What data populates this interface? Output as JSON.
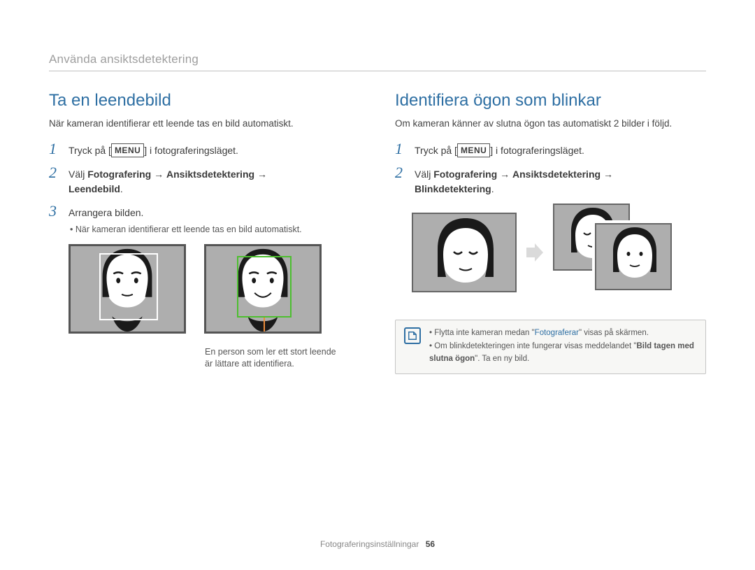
{
  "breadcrumb": "Använda ansiktsdetektering",
  "left": {
    "title": "Ta en leendebild",
    "intro": "När kameran identifierar ett leende tas en bild automatiskt.",
    "step1_pre": "Tryck på [",
    "menu_label": "MENU",
    "step1_post": "] i fotograferingsläget.",
    "step2_pre": "Välj ",
    "step2_b1": "Fotografering",
    "step2_arrow": " → ",
    "step2_b2": "Ansiktsdetektering",
    "step2_b3": "Leendebild",
    "step2_post": ".",
    "step3": "Arrangera bilden.",
    "sub_bullet": "När kameran identifierar ett leende tas en bild automatiskt.",
    "caption": "En person som ler ett stort leende är lättare att identifiera."
  },
  "right": {
    "title": "Identifiera ögon som blinkar",
    "intro": "Om kameran känner av slutna ögon tas automatiskt 2 bilder i följd.",
    "step1_pre": "Tryck på [",
    "menu_label": "MENU",
    "step1_post": "] i fotograferingsläget.",
    "step2_pre": "Välj ",
    "step2_b1": "Fotografering",
    "step2_arrow": " → ",
    "step2_b2": "Ansiktsdetektering",
    "step2_b3": "Blinkdetektering",
    "step2_post": "."
  },
  "note": {
    "li1_pre": "Flytta inte kameran medan \"",
    "li1_hl": "Fotograferar",
    "li1_post": "\" visas på skärmen.",
    "li2_pre": "Om blinkdetekteringen inte fungerar visas meddelandet \"",
    "li2_b": "Bild tagen med slutna ögon",
    "li2_post": "\". Ta en ny bild."
  },
  "footer": {
    "section": "Fotograferingsinställningar",
    "page": "56"
  }
}
